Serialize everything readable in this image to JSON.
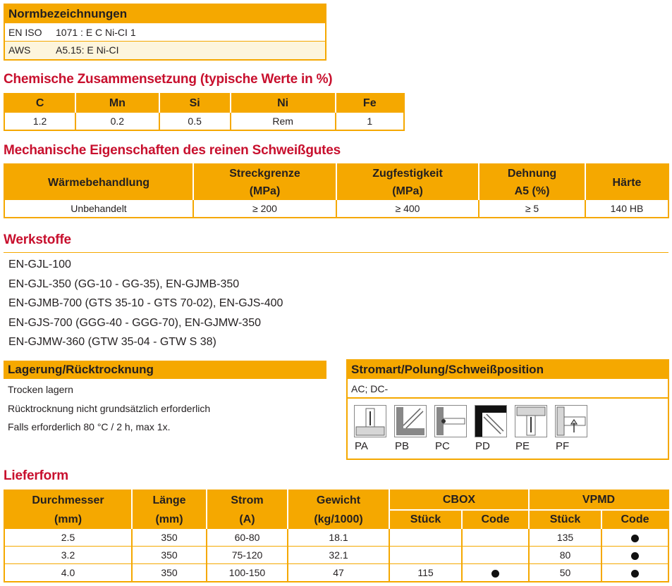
{
  "norm": {
    "title": "Normbezeichnungen",
    "rows": [
      {
        "std": "EN ISO",
        "value": "1071 : E C Ni-CI 1"
      },
      {
        "std": "AWS",
        "value": "A5.15: E Ni-CI"
      }
    ]
  },
  "chem": {
    "title": "Chemische Zusammensetzung (typische Werte in %)",
    "headers": [
      "C",
      "Mn",
      "Si",
      "Ni",
      "Fe"
    ],
    "values": [
      "1.2",
      "0.2",
      "0.5",
      "Rem",
      "1"
    ]
  },
  "mech": {
    "title": "Mechanische Eigenschaften des reinen Schweißgutes",
    "headers": [
      {
        "l1": "Wärmebehandlung",
        "l2": ""
      },
      {
        "l1": "Streckgrenze",
        "l2": "(MPa)"
      },
      {
        "l1": "Zugfestigkeit",
        "l2": "(MPa)"
      },
      {
        "l1": "Dehnung",
        "l2": "A5 (%)"
      },
      {
        "l1": "Härte",
        "l2": ""
      }
    ],
    "values": [
      "Unbehandelt",
      "≥ 200",
      "≥ 400",
      "≥ 5",
      "140 HB"
    ]
  },
  "werk": {
    "title": "Werkstoffe",
    "lines": [
      "EN-GJL-100",
      "EN-GJL-350 (GG-10 - GG-35), EN-GJMB-350",
      "EN-GJMB-700 (GTS 35-10 - GTS 70-02), EN-GJS-400",
      "EN-GJS-700 (GGG-40 - GGG-70), EN-GJMW-350",
      "EN-GJMW-360 (GTW 35-04 - GTW S 38)"
    ]
  },
  "lager": {
    "title": "Lagerung/Rücktrocknung",
    "lines": [
      "Trocken lagern",
      "Rücktrocknung nicht grundsätzlich erforderlich",
      "Falls erforderlich 80 °C / 2 h, max 1x."
    ]
  },
  "strom": {
    "title": "Stromart/Polung/Schweißposition",
    "value": "AC; DC-",
    "positions": [
      {
        "label": "PA",
        "icon": "weld-position-pa-icon",
        "active": false
      },
      {
        "label": "PB",
        "icon": "weld-position-pb-icon",
        "active": false
      },
      {
        "label": "PC",
        "icon": "weld-position-pc-icon",
        "active": false
      },
      {
        "label": "PD",
        "icon": "weld-position-pd-icon",
        "active": false
      },
      {
        "label": "PE",
        "icon": "weld-position-pe-icon",
        "active": false
      },
      {
        "label": "PF",
        "icon": "weld-position-pf-icon",
        "active": false
      }
    ]
  },
  "liefer": {
    "title": "Lieferform",
    "headers": {
      "durchmesser": "Durchmesser",
      "durchmesser_unit": "(mm)",
      "laenge": "Länge",
      "laenge_unit": "(mm)",
      "strom": "Strom",
      "strom_unit": "(A)",
      "gewicht": "Gewicht",
      "gewicht_unit": "(kg/1000)",
      "cbox": "CBOX",
      "vpmd": "VPMD",
      "stueck": "Stück",
      "code": "Code"
    },
    "rows": [
      {
        "d": "2.5",
        "l": "350",
        "a": "60-80",
        "g": "18.1",
        "cbox_st": "",
        "cbox_code": false,
        "vpmd_st": "135",
        "vpmd_code": true
      },
      {
        "d": "3.2",
        "l": "350",
        "a": "75-120",
        "g": "32.1",
        "cbox_st": "",
        "cbox_code": false,
        "vpmd_st": "80",
        "vpmd_code": true
      },
      {
        "d": "4.0",
        "l": "350",
        "a": "100-150",
        "g": "47",
        "cbox_st": "115",
        "cbox_code": true,
        "vpmd_st": "50",
        "vpmd_code": true
      }
    ]
  },
  "colors": {
    "accent": "#f5a800",
    "title_red": "#c8102e",
    "cream": "#fdf5dc"
  }
}
